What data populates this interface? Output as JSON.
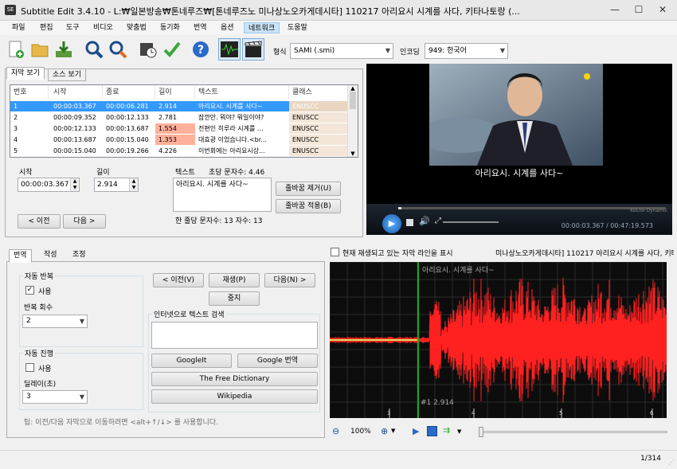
{
  "window": {
    "title": "Subtitle Edit 3.4.10 - L:₩일본방송₩톤네루즈₩[톤네루즈노 미나상노오카게데시타] 110217 아리요시 시계를 사다, 키타나토랑 (...",
    "app_icon": "SE",
    "minimize": "—",
    "maximize": "☐",
    "close": "✕"
  },
  "menu": [
    "파일",
    "편집",
    "도구",
    "비디오",
    "맞춤법",
    "동기화",
    "번역",
    "옵션",
    "네트워크",
    "도움말"
  ],
  "toolbar": {
    "format_label": "형식",
    "format_value": "SAMI (.smi)",
    "encoding_label": "인코딩",
    "encoding_value": "949: 한국어"
  },
  "list_tabs": [
    "자막 보기",
    "소스 보기"
  ],
  "grid": {
    "headers": [
      "번호",
      "시작",
      "종료",
      "길이",
      "텍스트",
      "클래스"
    ],
    "rows": [
      {
        "num": "1",
        "start": "00:00:03.367",
        "end": "00:00:06.281",
        "dur": "2.914",
        "text": "아리요시. 시계를 사다~",
        "cls": "ENUSCC",
        "selected": true,
        "warn": false
      },
      {
        "num": "2",
        "start": "00:00:09.352",
        "end": "00:00:12.133",
        "dur": "2.781",
        "text": "잠깐만. 뭐야? 뭐일이야?",
        "cls": "ENUSCC",
        "selected": false,
        "warn": false
      },
      {
        "num": "3",
        "start": "00:00:12.133",
        "end": "00:00:13.687",
        "dur": "1.554",
        "text": "전편인 히루라 시계를 ...",
        "cls": "ENUSCC",
        "selected": false,
        "warn": true
      },
      {
        "num": "4",
        "start": "00:00:13.687",
        "end": "00:00:15.040",
        "dur": "1.353",
        "text": "대효광 이었습니다.<br...",
        "cls": "ENUSCC",
        "selected": false,
        "warn": true
      },
      {
        "num": "5",
        "start": "00:00:15.040",
        "end": "00:00:19.266",
        "dur": "4.226",
        "text": "이번회에는 아리요시상...",
        "cls": "ENUSCC",
        "selected": false,
        "warn": false
      }
    ]
  },
  "editor": {
    "start_label": "시작",
    "start_value": "00:00:03.367",
    "dur_label": "길이",
    "dur_value": "2.914",
    "text_label": "텍스트",
    "cps_label": "초당 문자수: 4.46",
    "text_value": "아리요시. 시계를 사다~",
    "remove_lb": "줄바꿈 제거(U)",
    "apply_lb": "줄바꿈 적용(B)",
    "line_info": "한 줄당 문자수: 13 자수: 13",
    "prev": "< 이전",
    "next": "다음 >"
  },
  "video": {
    "subtitle": "아리요시. 시계를 사다~",
    "logo": "KoLite Dynamic",
    "time": "00:00:03.367 / 00:47:19.573"
  },
  "bottom_tabs": [
    "번역",
    "작성",
    "조정"
  ],
  "translate": {
    "auto_repeat": "자동 반복",
    "use1": "사용",
    "use1_checked": true,
    "repeat_count_label": "반복 회수",
    "repeat_count": "2",
    "auto_continue": "자동 진행",
    "use2": "사용",
    "use2_checked": false,
    "delay_label": "딜레이(초)",
    "delay": "3",
    "prev_btn": "< 이전(V)",
    "play_btn": "재생(P)",
    "next_btn": "다음(N) >",
    "stop_btn": "중지",
    "search_label": "인터넷으로 텍스트 검색",
    "googleit": "GoogleIt",
    "google_translate": "Google 번역",
    "free_dict": "The Free Dictionary",
    "wikipedia": "Wikipedia",
    "tip": "팁: 이전/다음 자막으로 이동하려면 <alt+↑/↓> 를 사용합니다."
  },
  "waveform": {
    "show_line_label": "현재 재생되고 있는 자막 라인을 표시",
    "file_label": "미나상노오카게데시타] 110217 아리요시 시계를 사다, 키타",
    "sub_text": "아리요시. 시계를 사다~",
    "marker": "#1  2.914",
    "ticks": [
      "3",
      "4",
      "5",
      "6"
    ],
    "zoom": "100%",
    "wave_color": "#ff2020",
    "line_color": "#1aa81a"
  },
  "status": {
    "position": "1/314"
  }
}
